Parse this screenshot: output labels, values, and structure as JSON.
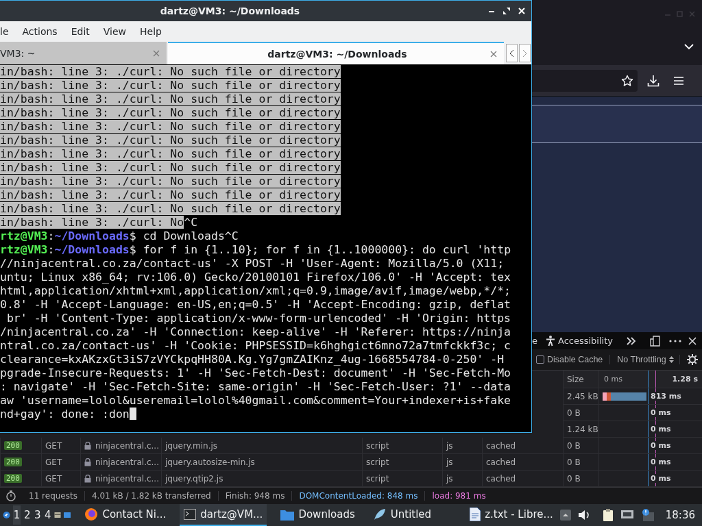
{
  "terminal_window": {
    "title": "dartz@VM3: ~/Downloads",
    "menu": [
      "le",
      "Actions",
      "Edit",
      "View",
      "Help"
    ],
    "tabs": [
      {
        "label": "VM3: ~",
        "selected": false
      },
      {
        "label": "dartz@VM3: ~/Downloads",
        "selected": true
      }
    ],
    "lines": [
      {
        "kind": "output",
        "text": "in/bash: line 3: ./curl: No such file or directory",
        "selected": true
      },
      {
        "kind": "output",
        "text": "in/bash: line 3: ./curl: No such file or directory",
        "selected": true
      },
      {
        "kind": "output",
        "text": "in/bash: line 3: ./curl: No such file or directory",
        "selected": true
      },
      {
        "kind": "output",
        "text": "in/bash: line 3: ./curl: No such file or directory",
        "selected": true
      },
      {
        "kind": "output",
        "text": "in/bash: line 3: ./curl: No such file or directory",
        "selected": true
      },
      {
        "kind": "output",
        "text": "in/bash: line 3: ./curl: No such file or directory",
        "selected": true
      },
      {
        "kind": "output",
        "text": "in/bash: line 3: ./curl: No such file or directory",
        "selected": true
      },
      {
        "kind": "output",
        "text": "in/bash: line 3: ./curl: No such file or directory",
        "selected": true
      },
      {
        "kind": "output",
        "text": "in/bash: line 3: ./curl: No such file or directory",
        "selected": true
      },
      {
        "kind": "output",
        "text": "in/bash: line 3: ./curl: No such file or directory",
        "selected": true
      },
      {
        "kind": "output",
        "text": "in/bash: line 3: ./curl: No such file or directory",
        "selected": true
      },
      {
        "kind": "output",
        "text": "in/bash: line 3: ./curl: No",
        "selected": true,
        "tail": "^C"
      },
      {
        "kind": "prompt",
        "user": "rtz@VM3",
        "colon": ":",
        "path": "~/Downloads",
        "command": "$ cd Downloads^C"
      },
      {
        "kind": "prompt",
        "user": "rtz@VM3",
        "colon": ":",
        "path": "~/Downloads",
        "command": "$ for f in {1..10}; for f in {1..1000000}: do curl 'http"
      },
      {
        "kind": "output",
        "text": "//ninjacentral.co.za/contact-us' -X POST -H 'User-Agent: Mozilla/5.0 (X11;",
        "selected": false
      },
      {
        "kind": "output",
        "text": "untu; Linux x86_64; rv:106.0) Gecko/20100101 Firefox/106.0' -H 'Accept: tex",
        "selected": false
      },
      {
        "kind": "output",
        "text": "html,application/xhtml+xml,application/xml;q=0.9,image/avif,image/webp,*/*;",
        "selected": false
      },
      {
        "kind": "output",
        "text": "0.8' -H 'Accept-Language: en-US,en;q=0.5' -H 'Accept-Encoding: gzip, deflat",
        "selected": false
      },
      {
        "kind": "output",
        "text": " br' -H 'Content-Type: application/x-www-form-urlencoded' -H 'Origin: https",
        "selected": false
      },
      {
        "kind": "output",
        "text": "/ninjacentral.co.za' -H 'Connection: keep-alive' -H 'Referer: https://ninja",
        "selected": false
      },
      {
        "kind": "output",
        "text": "ntral.co.za/contact-us' -H 'Cookie: PHPSESSID=k6hghgict6mno72a7tmfckkf3c; c",
        "selected": false
      },
      {
        "kind": "output",
        "text": "clearance=kxAKzxGt3iS7zVYCkpqHH80A.Kg.Yg7gmZAIKnz_4ug-1668554784-0-250' -H",
        "selected": false
      },
      {
        "kind": "output",
        "text": "pgrade-Insecure-Requests: 1' -H 'Sec-Fetch-Dest: document' -H 'Sec-Fetch-Mo",
        "selected": false
      },
      {
        "kind": "output",
        "text": ": navigate' -H 'Sec-Fetch-Site: same-origin' -H 'Sec-Fetch-User: ?1' --data",
        "selected": false
      },
      {
        "kind": "output",
        "text": "aw 'username=lolol&useremail=lolol%40gmail.com&comment=Your+indexer+is+fake",
        "selected": false
      },
      {
        "kind": "output",
        "text": "nd+gay': done: :don",
        "selected": false,
        "cursor": true
      }
    ]
  },
  "browser": {
    "devtools": {
      "tabs": [
        "e",
        "Accessibility"
      ],
      "disable_cache": {
        "label": "Disable Cache",
        "checked": false
      },
      "throttling": "No Throttling",
      "header": {
        "size": "Size",
        "start": "0 ms",
        "end": "1.28 s"
      },
      "rows": [
        {
          "size": "2.45 kB",
          "timing": "813 ms",
          "level": 0.46
        },
        {
          "size": "0 B",
          "timing": "0 ms"
        },
        {
          "size": "1.24 kB",
          "timing": "0 ms"
        },
        {
          "status": "200",
          "method": "GET",
          "domain": "ninjacentral.c...",
          "file": "jquery.min.js",
          "type": "script",
          "ext": "js",
          "transferred": "cached",
          "size": "0 B",
          "timing": "0 ms"
        },
        {
          "status": "200",
          "method": "GET",
          "domain": "ninjacentral.c...",
          "file": "jquery.autosize-min.js",
          "type": "script",
          "ext": "js",
          "transferred": "cached",
          "size": "0 B",
          "timing": "0 ms"
        },
        {
          "status": "200",
          "method": "GET",
          "domain": "ninjacentral.c...",
          "file": "jquery.qtip2.js",
          "type": "script",
          "ext": "js",
          "transferred": "cached",
          "size": "0 B",
          "timing": "0 ms"
        }
      ],
      "status": {
        "requests": "11 requests",
        "transferred": "4.01 kB / 1.82 kB transferred",
        "finish": "Finish: 948 ms",
        "dom": "DOMContentLoaded: 848 ms",
        "load": "load: 981 ms"
      }
    }
  },
  "taskbar": {
    "workspaces": [
      {
        "label": "1",
        "selected": true
      },
      {
        "label": "2",
        "selected": false
      },
      {
        "label": "3",
        "selected": false
      },
      {
        "label": "4",
        "selected": false
      }
    ],
    "tasks": [
      {
        "kind": "firefox",
        "label": "Contact Ni...",
        "selected": false
      },
      {
        "kind": "terminal",
        "label": "dartz@VM...",
        "selected": true
      },
      {
        "kind": "folder",
        "label": "Downloads",
        "selected": false
      },
      {
        "kind": "editor",
        "label": "Untitled",
        "selected": false
      },
      {
        "kind": "document",
        "label": "z.txt - Libre...",
        "selected": false
      }
    ],
    "clock": "18:36"
  }
}
